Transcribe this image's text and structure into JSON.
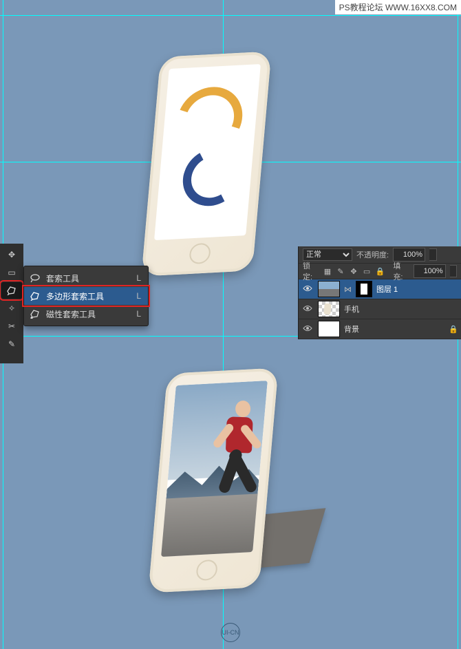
{
  "watermark": "PS教程论坛 WWW.16XX8.COM",
  "tool_flyout": {
    "items": [
      {
        "label": "套索工具",
        "shortcut": "L"
      },
      {
        "label": "多边形套索工具",
        "shortcut": "L"
      },
      {
        "label": "磁性套索工具",
        "shortcut": "L"
      }
    ],
    "selected_index": 1
  },
  "toolbox": {
    "tools": [
      "move",
      "marquee",
      "polygonal-lasso",
      "magic-wand",
      "crop",
      "eyedropper",
      "brush"
    ],
    "active_index": 2
  },
  "layers": {
    "blend_mode_label": "正常",
    "opacity_label": "不透明度:",
    "opacity_value": "100%",
    "lock_label": "锁定:",
    "fill_label": "填充:",
    "fill_value": "100%",
    "rows": [
      {
        "name": "图层 1",
        "has_mask": true,
        "visible": true
      },
      {
        "name": "手机",
        "has_mask": false,
        "visible": true
      },
      {
        "name": "背景",
        "has_mask": false,
        "visible": true,
        "locked": true
      }
    ],
    "selected_index": 0
  },
  "uicn": "UI-CN",
  "guides": {
    "v": [
      4,
      324,
      665
    ],
    "h": [
      22,
      235,
      488,
      943
    ]
  }
}
